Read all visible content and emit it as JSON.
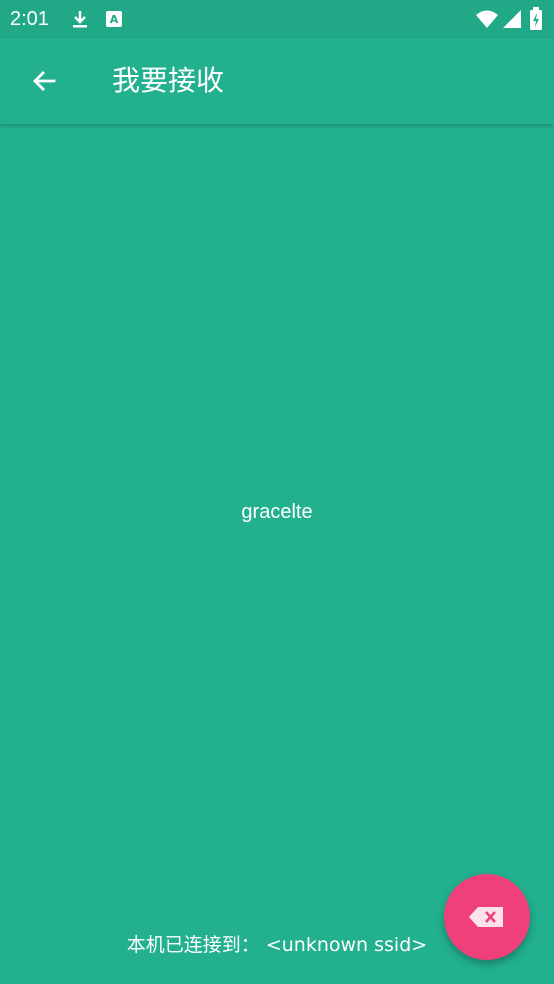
{
  "status_bar": {
    "time": "2:01",
    "icons": [
      "download-icon",
      "a-notification-icon",
      "wifi-icon",
      "signal-icon",
      "battery-charging-icon"
    ]
  },
  "app_bar": {
    "title": "我要接收",
    "back_icon": "arrow-left-icon"
  },
  "radar": {
    "device_name": "gracelte"
  },
  "footer": {
    "connection_text": "本机已连接到： <unknown ssid>"
  },
  "fab": {
    "icon": "backspace-icon"
  },
  "colors": {
    "background": "#22b08e",
    "status_bar": "#21a886",
    "fab": "#f0407c",
    "text": "#ffffff"
  }
}
